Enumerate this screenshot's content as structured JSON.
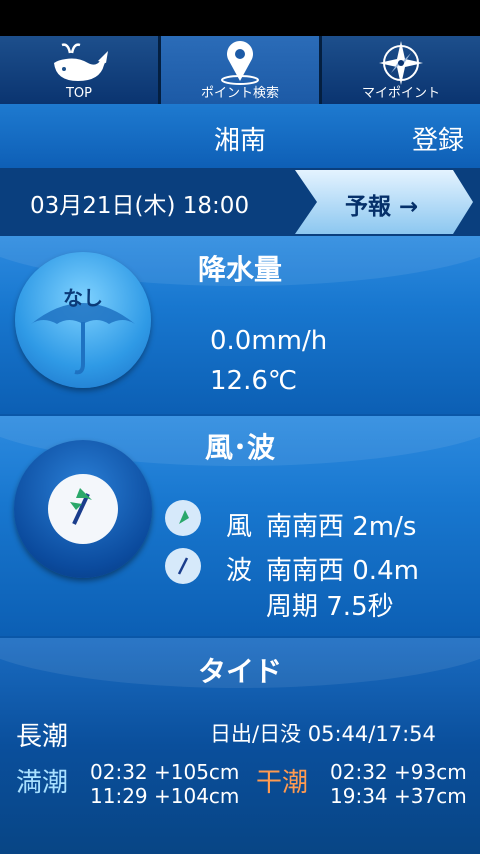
{
  "tabs": [
    {
      "label": "TOP",
      "icon": "whale-icon"
    },
    {
      "label": "ポイント検索",
      "icon": "map-pin-icon"
    },
    {
      "label": "マイポイント",
      "icon": "compass-icon"
    }
  ],
  "header": {
    "title": "湘南",
    "register_label": "登録"
  },
  "datebar": {
    "datetime": "03月21日(木) 18:00",
    "forecast_label": "予報 →"
  },
  "rain": {
    "title": "降水量",
    "badge": "なし",
    "precipitation": "0.0mm/h",
    "temperature": "12.6℃"
  },
  "wind_wave": {
    "title": "風･波",
    "wind_label": "風",
    "wind_value": "南南西 2m/s",
    "wave_label": "波",
    "wave_value": "南南西 0.4m",
    "period_value": "周期 7.5秒"
  },
  "tide": {
    "title": "タイド",
    "type": "長潮",
    "sun": "日出/日没 05:44/17:54",
    "high_label": "満潮",
    "high_1": "02:32 +105cm",
    "high_2": "11:29 +104cm",
    "low_label": "干潮",
    "low_1": "02:32 +93cm",
    "low_2": "19:34 +37cm"
  },
  "colors": {
    "high_tide": "#a8e0ff",
    "low_tide": "#ff9a50",
    "accent": "#1d6fca"
  }
}
